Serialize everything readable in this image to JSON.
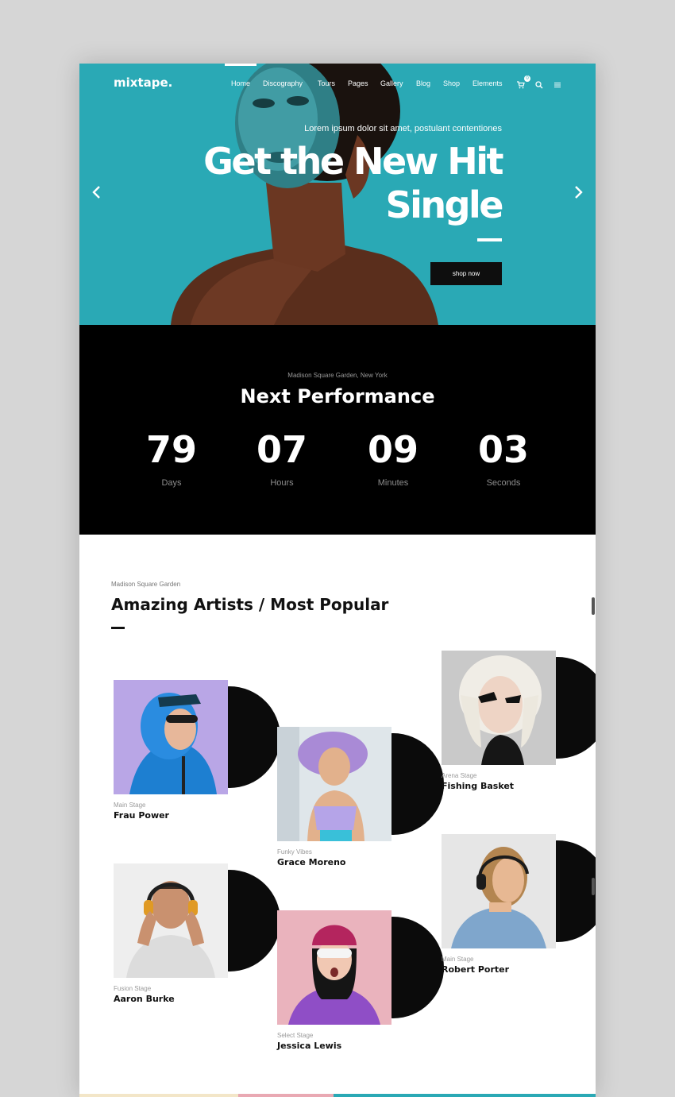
{
  "header": {
    "logo": "mixtape.",
    "nav": [
      "Home",
      "Discography",
      "Tours",
      "Pages",
      "Gallery",
      "Blog",
      "Shop",
      "Elements"
    ],
    "cart_count": "0",
    "icons": [
      "cart-icon",
      "search-icon",
      "menu-icon"
    ]
  },
  "hero": {
    "subtitle": "Lorem ipsum dolor sit amet, postulant contentiones",
    "title_line1": "Get the New Hit",
    "title_line2": "Single",
    "button": "shop now",
    "arrows": [
      "chevron-left-icon",
      "chevron-right-icon"
    ]
  },
  "countdown": {
    "venue": "Madison Square Garden, New York",
    "title": "Next Performance",
    "units": [
      {
        "value": "79",
        "label": "Days"
      },
      {
        "value": "07",
        "label": "Hours"
      },
      {
        "value": "09",
        "label": "Minutes"
      },
      {
        "value": "03",
        "label": "Seconds"
      }
    ]
  },
  "artists_section": {
    "kicker": "Madison Square Garden",
    "title": "Amazing Artists / Most Popular",
    "artists": [
      {
        "stage": "Main Stage",
        "name": "Frau Power"
      },
      {
        "stage": "Funky Vibes",
        "name": "Grace Moreno"
      },
      {
        "stage": "Arena Stage",
        "name": "Fishing Basket"
      },
      {
        "stage": "Fusion Stage",
        "name": "Aaron Burke"
      },
      {
        "stage": "Select Stage",
        "name": "Jessica Lewis"
      },
      {
        "stage": "Main Stage",
        "name": "Robert Porter"
      }
    ]
  },
  "colors": {
    "accent": "#2aa9b5",
    "dark": "#000000",
    "text": "#111111"
  }
}
